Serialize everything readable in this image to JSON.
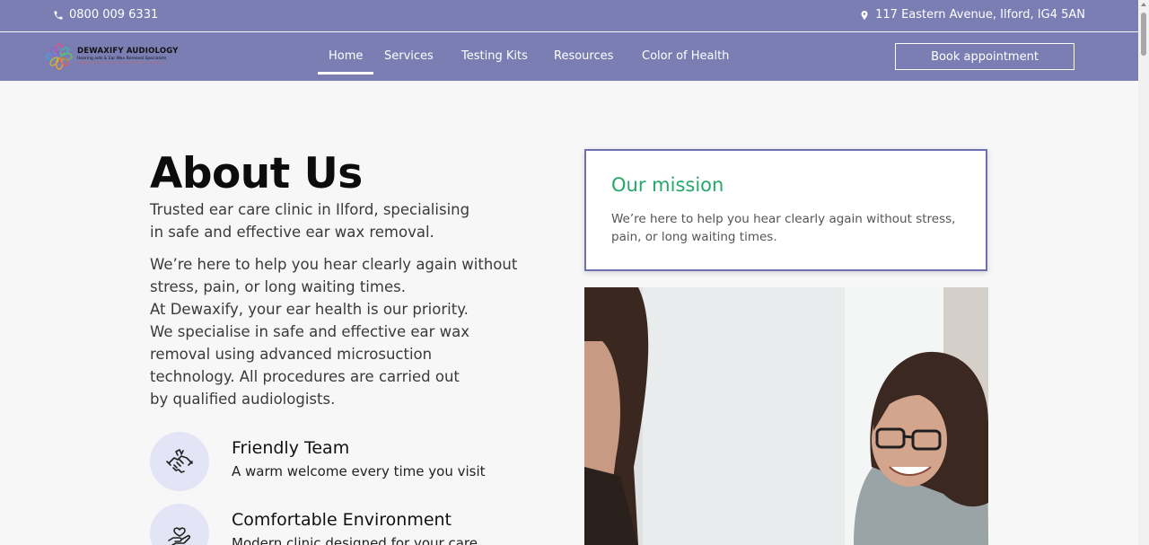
{
  "topbar": {
    "phone": "0800 009 6331",
    "address": "117 Eastern Avenue, Ilford, IG4 5AN",
    "phone_icon": "phone-icon",
    "address_icon": "map-pin-icon"
  },
  "brand": {
    "name": "DEWAXIFY AUDIOLOGY",
    "tagline": "Hearing aids & Ear Wax Removal Specialists",
    "subtagline": "BRINGING BACK THE COMFORT OF SOUND"
  },
  "nav": {
    "items": [
      {
        "label": "Home",
        "active": true
      },
      {
        "label": "Services",
        "active": false
      },
      {
        "label": "Testing Kits",
        "active": false
      },
      {
        "label": "Resources",
        "active": false
      },
      {
        "label": "Color of Health",
        "active": false
      }
    ],
    "cta": "Book appointment"
  },
  "about": {
    "title": "About Us",
    "lead_1": "Trusted ear care clinic in Ilford, specialising",
    "lead_2": "in safe and effective ear wax removal.",
    "body_1": "We’re here to help you hear clearly again without",
    "body_2": "stress, pain, or long waiting times.",
    "body_3": "At Dewaxify, your ear health is our priority.",
    "body_4": "We specialise in safe and effective ear wax",
    "body_5": "removal using advanced microsuction",
    "body_6": "technology. All procedures are carried out",
    "body_7": "by qualified audiologists."
  },
  "features": [
    {
      "title": "Friendly Team",
      "description": "A warm welcome every time you visit",
      "icon": "handshake-icon"
    },
    {
      "title": "Comfortable Environment",
      "description": "Modern clinic designed for your care",
      "icon": "heart-hand-icon"
    }
  ],
  "mission": {
    "title": "Our mission",
    "text": "We’re here to help you hear clearly again without stress, pain, or long waiting times."
  },
  "colors": {
    "header_bg": "#7a7eb3",
    "accent_green": "#25a86a",
    "feature_circle": "#e3e4f6",
    "mission_border": "#6d70ad"
  }
}
